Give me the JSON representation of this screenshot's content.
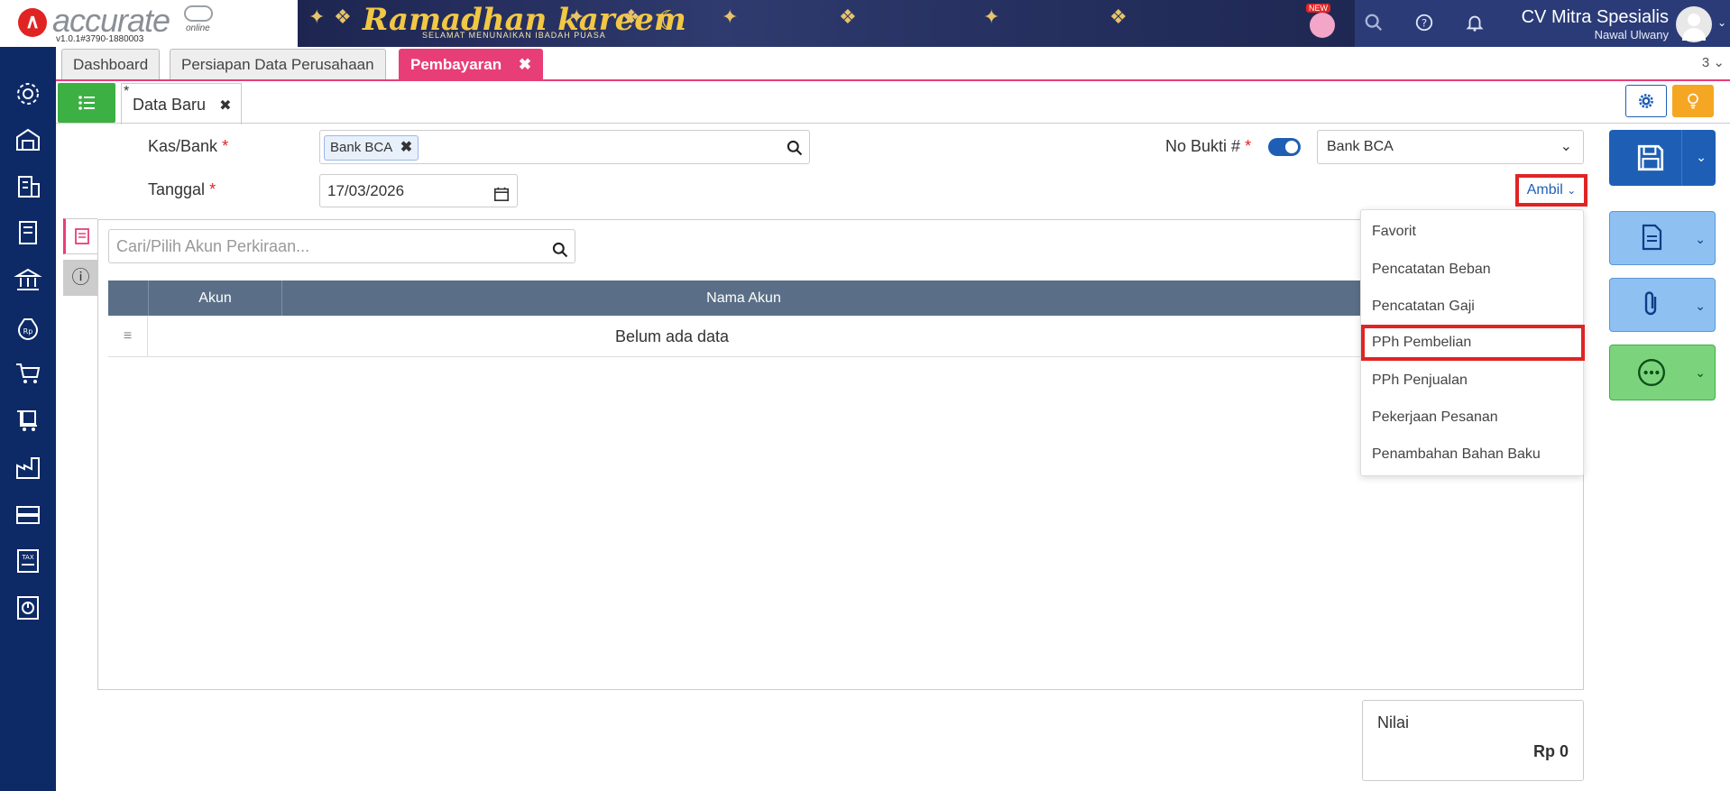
{
  "app": {
    "logo_text": "accurate",
    "logo_sub": "online",
    "version": "v1.0.1#3790-1880003"
  },
  "banner": {
    "title": "Ramadhan kareem",
    "subtitle": "SELAMAT MENUNAIKAN IBADAH PUASA",
    "new_badge": "NEW"
  },
  "header": {
    "company": "CV Mitra Spesialis",
    "user": "Nawal Ulwany"
  },
  "tabs": [
    {
      "label": "Dashboard"
    },
    {
      "label": "Persiapan Data Perusahaan"
    },
    {
      "label": "Pembayaran",
      "close": "✖"
    }
  ],
  "tab_count": "3",
  "subtab": {
    "modified_mark": "*",
    "label": "Data Baru",
    "close": "✖"
  },
  "form": {
    "kas_label": "Kas/Bank",
    "kas_value": "Bank BCA",
    "required_mark": "*",
    "bukti_label": "No Bukti #",
    "bukti_select": "Bank BCA",
    "tanggal_label": "Tanggal",
    "tanggal_value": "17/03/2026",
    "ambil_label": "Ambil"
  },
  "search": {
    "placeholder": "Cari/Pilih Akun Perkiraan..."
  },
  "table": {
    "columns": [
      "Akun",
      "Nama Akun"
    ],
    "empty_text": "Belum ada data"
  },
  "ambil_menu": {
    "items": [
      "Favorit",
      "Pencatatan Beban",
      "Pencatatan Gaji",
      "PPh Pembelian",
      "PPh Penjualan",
      "Pekerjaan Pesanan",
      "Penambahan Bahan Baku"
    ],
    "highlighted": "PPh Pembelian"
  },
  "nilai": {
    "label": "Nilai",
    "value": "Rp 0"
  },
  "colors": {
    "primary": "#1e5fb5",
    "accent": "#e83e77",
    "sidebar": "#0d2a66",
    "green": "#3cb043",
    "highlight": "#e02424"
  }
}
